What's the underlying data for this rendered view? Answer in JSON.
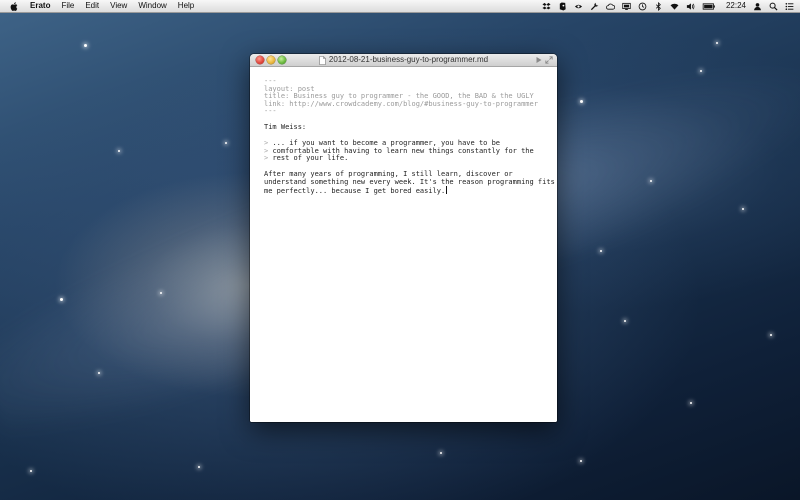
{
  "menubar": {
    "app_name": "Erato",
    "menus": [
      "File",
      "Edit",
      "View",
      "Window",
      "Help"
    ],
    "status_icons": [
      "dropbox-icon",
      "evernote-icon",
      "mail-icon",
      "wrench-icon",
      "cloud-icon",
      "display-icon",
      "time-machine-icon",
      "bluetooth-icon",
      "wifi-icon",
      "volume-icon",
      "battery-icon"
    ],
    "clock": "22:24",
    "right_icons": [
      "user-icon",
      "spotlight-icon",
      "notification-center-icon"
    ]
  },
  "window": {
    "title": "2012-08-21-business-guy-to-programmer.md",
    "front_matter": [
      "---",
      "layout: post",
      "title: Business guy to programmer - the GOOD, the BAD & the UGLY",
      "link: http://www.crowdcademy.com/blog/#business-guy-to-programmer",
      "---"
    ],
    "author_line": "Tim Weiss:",
    "quote_marker": ">",
    "quote_lines": [
      "... if you want to become a programmer, you have to be",
      "comfortable with having to learn new things constantly for the",
      "rest of your life."
    ],
    "paragraph_lines": [
      "After many years of programming, I still learn, discover or",
      "understand something new every week. It's the reason programming fits",
      "me perfectly... because I get bored easily."
    ]
  }
}
